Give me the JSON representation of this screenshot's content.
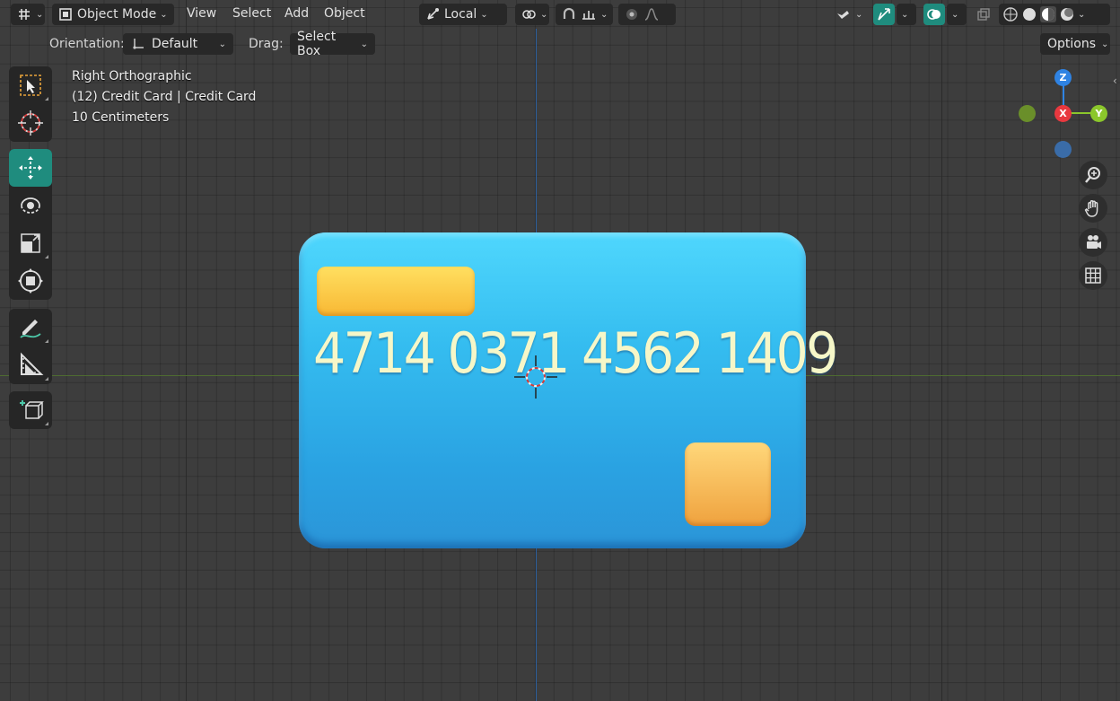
{
  "header": {
    "editor_type_icon": "viewport-icon",
    "mode": "Object Mode",
    "menus": [
      "View",
      "Select",
      "Add",
      "Object"
    ],
    "transform_orientation": "Local",
    "pivot_icon": "pivot-icon",
    "snap_icon": "magnet-icon",
    "snap_increment_icon": "snap-increment-icon",
    "proportional_icon": "proportional-edit-icon",
    "falloff_icon": "falloff-curve-icon",
    "visibility_icon": "object-visibility-icon",
    "gizmo_icon": "gizmo-icon",
    "overlay_icon": "overlay-icon",
    "xray_icon": "xray-icon",
    "shading_icons": [
      "wireframe-shading-icon",
      "solid-shading-icon",
      "material-shading-icon",
      "rendered-shading-icon"
    ]
  },
  "tool_header": {
    "orientation_label": "Orientation:",
    "orientation_value": "Default",
    "drag_label": "Drag:",
    "drag_value": "Select Box",
    "options_label": "Options"
  },
  "toolbar": {
    "tools": [
      "select-box-icon",
      "cursor-icon",
      "move-icon",
      "rotate-icon",
      "scale-icon",
      "transform-icon",
      "annotate-icon",
      "measure-icon",
      "add-cube-icon"
    ],
    "active_tool": "move-icon"
  },
  "overlay_text": {
    "view_name": "Right Orthographic",
    "object_info": "(12) Credit Card | Credit Card",
    "scale_info": "10 Centimeters"
  },
  "gizmo": {
    "z": "Z",
    "x": "X",
    "y": "Y",
    "colors": {
      "z": "#2f83e3",
      "x": "#e8383f",
      "y": "#8bc72b",
      "neg_y": "#6a8f2a",
      "neg_z": "#3a6ca8"
    }
  },
  "nav_buttons": [
    "zoom-icon",
    "pan-hand-icon",
    "camera-icon",
    "ortho-grid-icon"
  ],
  "card": {
    "number": "4714 0371 4562 1409",
    "body_color": "#35bdf0",
    "stripe_color": "#f8c23a",
    "chip_color": "#f4b253",
    "text_color": "#f6f7c8"
  }
}
